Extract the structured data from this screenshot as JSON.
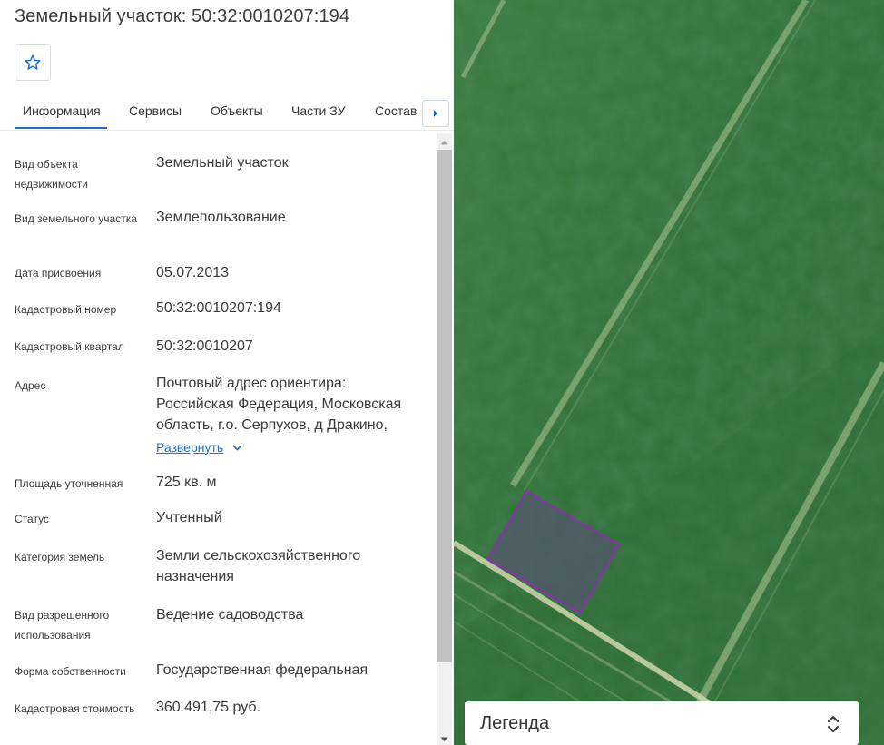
{
  "panel": {
    "title": "Земельный участок: 50:32:0010207:194",
    "favorite_icon": "star-outline-icon",
    "tabs": [
      {
        "label": "Информация",
        "active": true
      },
      {
        "label": "Сервисы",
        "active": false
      },
      {
        "label": "Объекты",
        "active": false
      },
      {
        "label": "Части ЗУ",
        "active": false
      },
      {
        "label": "Состав",
        "active": false
      }
    ],
    "tabs_next_icon": "caret-right-icon",
    "expand_label": "Развернуть",
    "expand_icon": "chevron-down-icon",
    "rows": [
      {
        "label": "Вид объекта недвижимости",
        "value": "Земельный участок"
      },
      {
        "label": "Вид земельного участка",
        "value": "Землепользование"
      },
      {
        "label": "Дата присвоения",
        "value": "05.07.2013"
      },
      {
        "label": "Кадастровый номер",
        "value": "50:32:0010207:194"
      },
      {
        "label": "Кадастровый квартал",
        "value": "50:32:0010207"
      },
      {
        "label": "Адрес",
        "value": "Почтовый адрес ориентира: Российская Федерация, Московская область, г.о. Серпухов, д Дракино,"
      },
      {
        "label": "Площадь уточненная",
        "value": "725 кв. м"
      },
      {
        "label": "Статус",
        "value": "Учтенный"
      },
      {
        "label": "Категория земель",
        "value": "Земли сельскохозяйственного назначения"
      },
      {
        "label": "Вид разрешенного использования",
        "value": "Ведение садоводства"
      },
      {
        "label": "Форма собственности",
        "value": "Государственная федеральная"
      },
      {
        "label": "Кадастровая стоимость",
        "value": "360 491,75 руб."
      }
    ]
  },
  "map": {
    "legend_title": "Легенда",
    "legend_toggle_icon": "expand-collapse-icon",
    "parcel_outline_color": "#8e2fb0",
    "accent_color": "#1f6fd0"
  }
}
